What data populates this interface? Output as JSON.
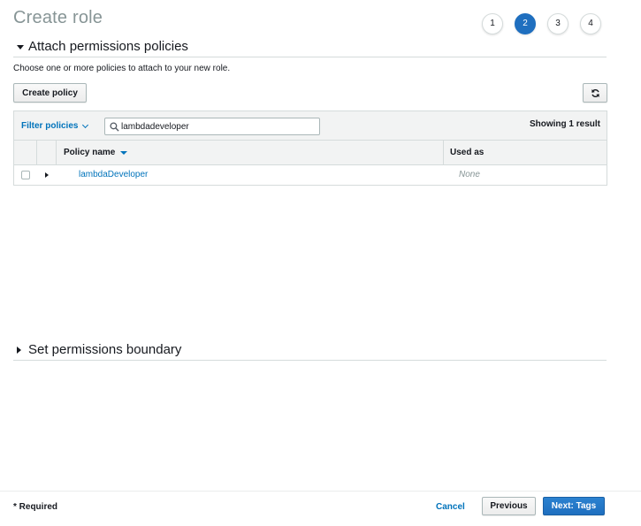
{
  "page": {
    "title": "Create role"
  },
  "steps": [
    {
      "label": "1",
      "active": false
    },
    {
      "label": "2",
      "active": true
    },
    {
      "label": "3",
      "active": false
    },
    {
      "label": "4",
      "active": false
    }
  ],
  "attach_section": {
    "title": "Attach permissions policies",
    "description": "Choose one or more policies to attach to your new role.",
    "create_policy_label": "Create policy",
    "refresh_icon": "refresh-icon"
  },
  "filter": {
    "label": "Filter policies",
    "search_value": "lambdadeveloper",
    "result_count": "Showing 1 result"
  },
  "table": {
    "columns": {
      "policy_name": "Policy name",
      "used_as": "Used as"
    },
    "rows": [
      {
        "policy_name": "lambdaDeveloper",
        "used_as": "None"
      }
    ]
  },
  "boundary_section": {
    "title": "Set permissions boundary"
  },
  "footer": {
    "required_note": "* Required",
    "cancel_label": "Cancel",
    "previous_label": "Previous",
    "next_label": "Next: Tags"
  },
  "colors": {
    "accent": "#1f6fbf",
    "link": "#0073bb",
    "muted": "#879596"
  }
}
